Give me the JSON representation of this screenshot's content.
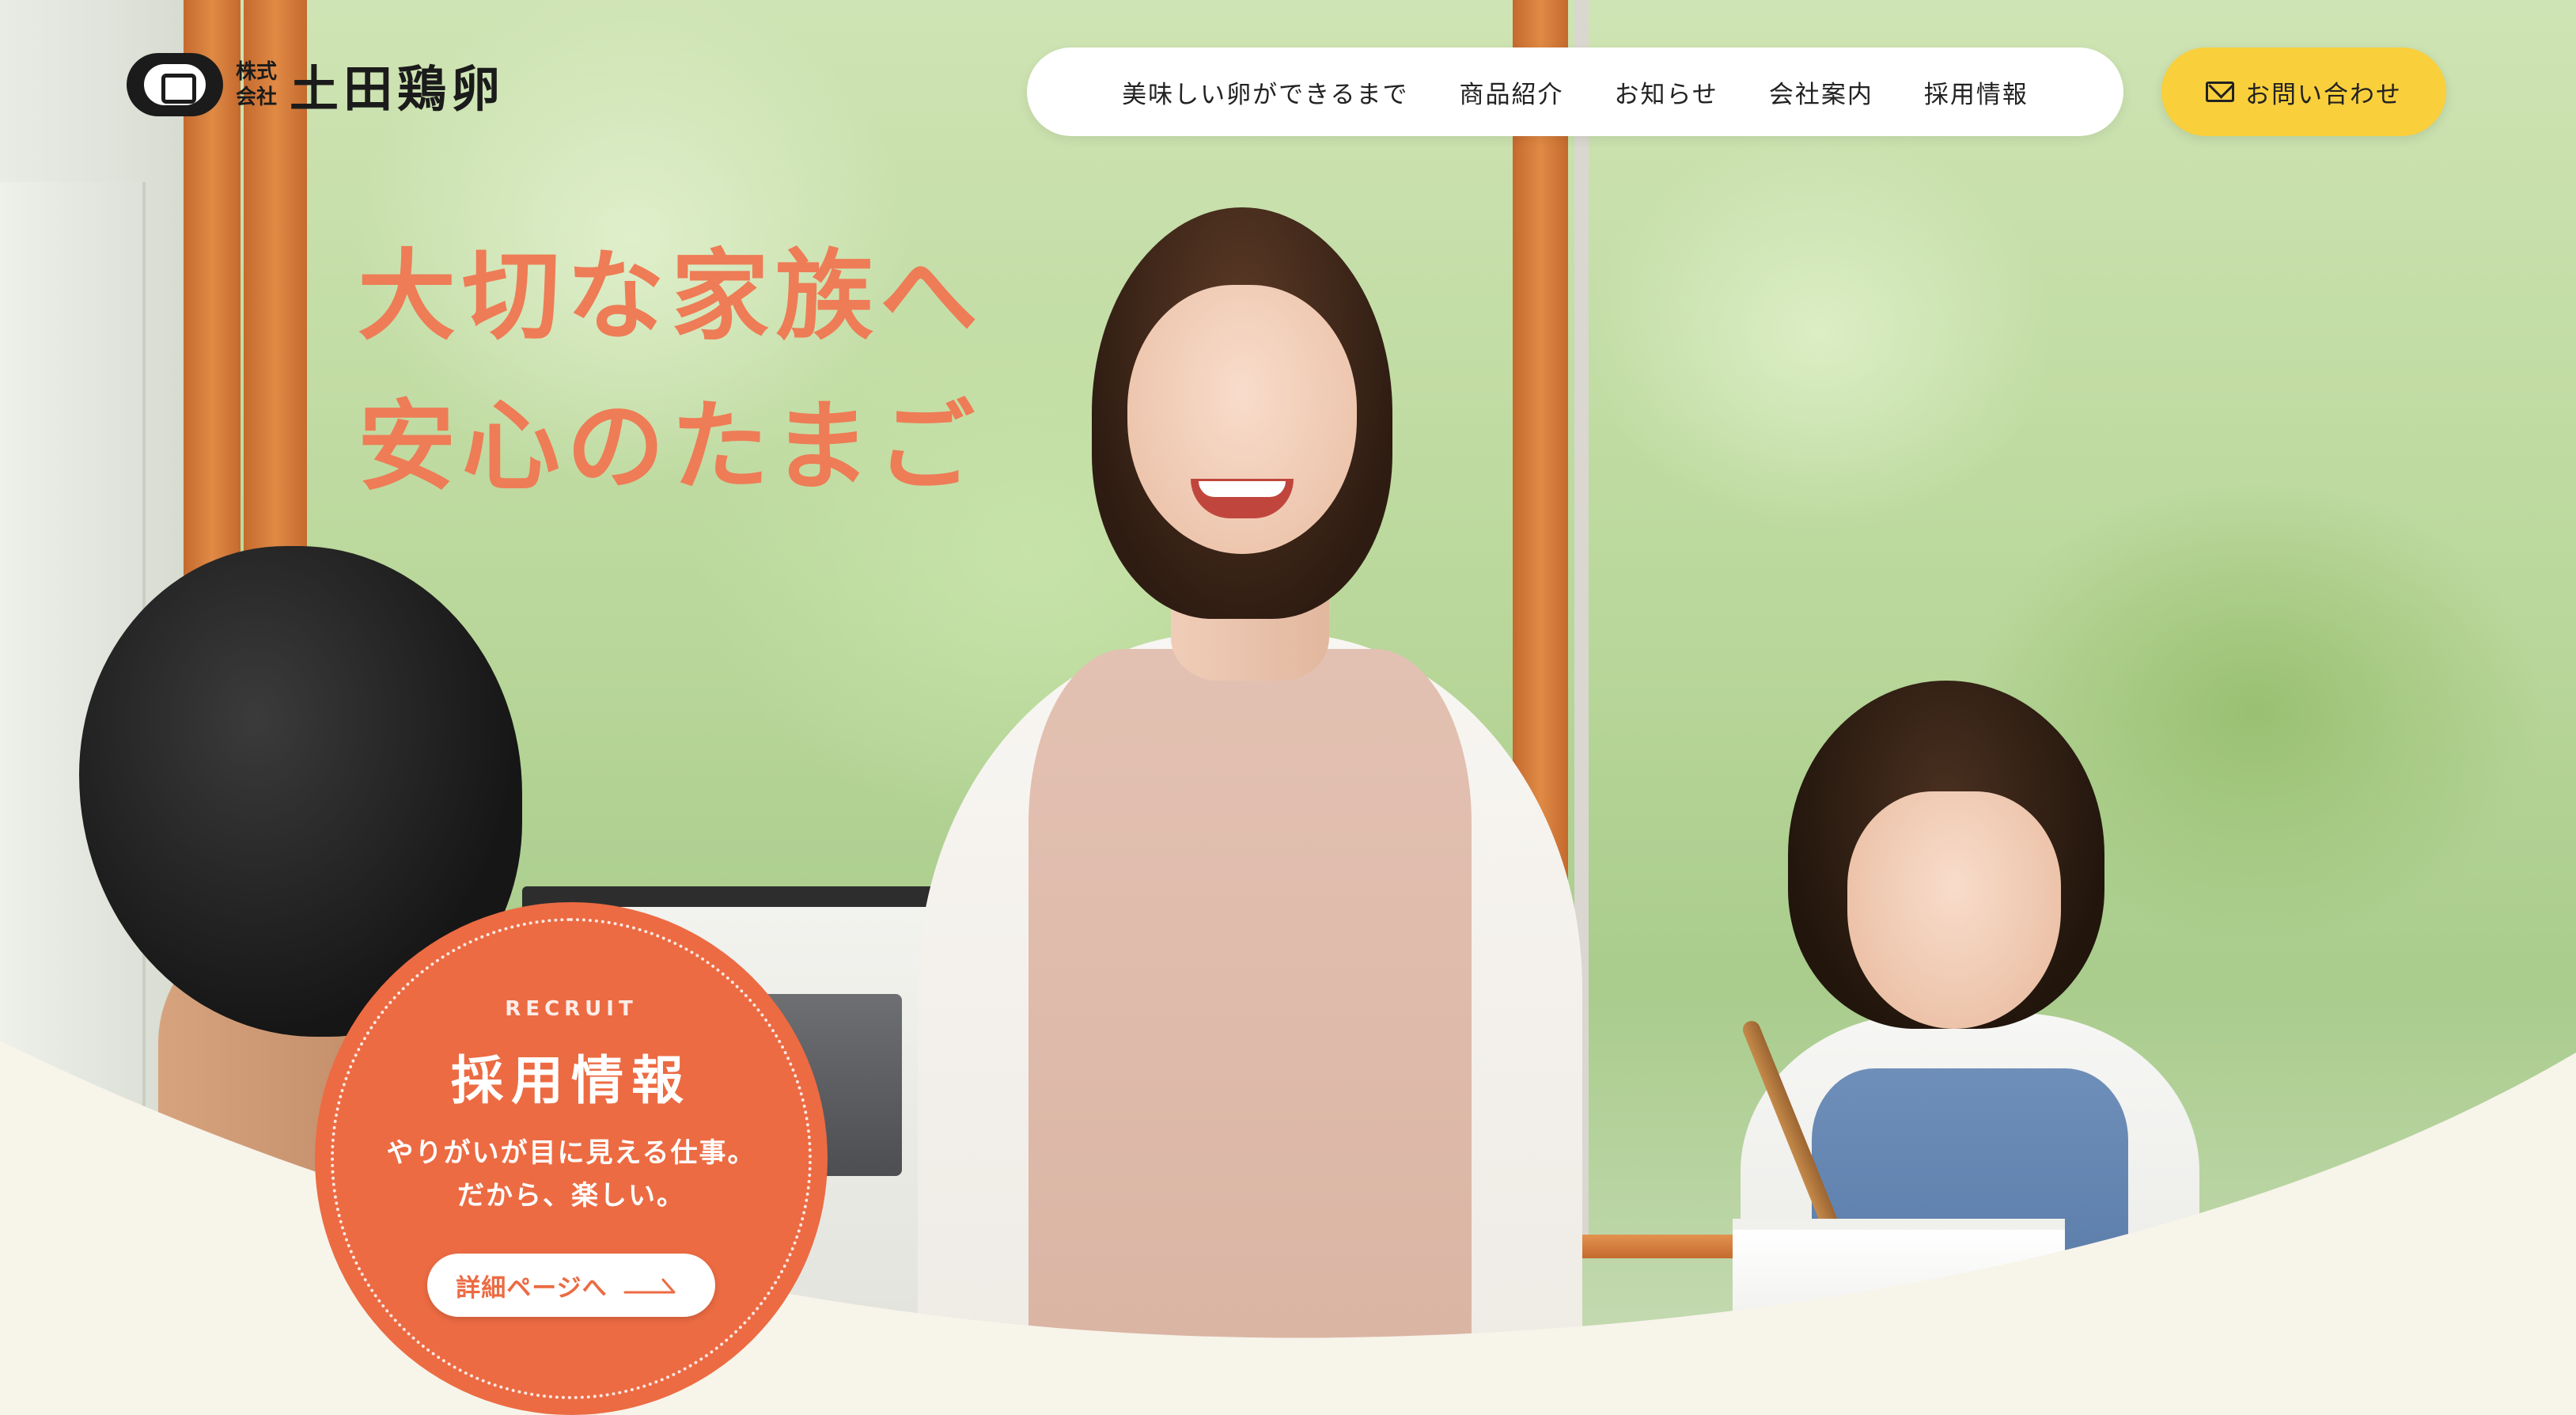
{
  "header": {
    "logo": {
      "small_top": "株式",
      "small_bottom": "会社",
      "name": "土田鶏卵"
    },
    "nav": {
      "items": [
        {
          "label": "美味しい卵ができるまで"
        },
        {
          "label": "商品紹介"
        },
        {
          "label": "お知らせ"
        },
        {
          "label": "会社案内"
        },
        {
          "label": "採用情報"
        }
      ]
    },
    "contact": {
      "label": "お問い合わせ",
      "icon": "mail-icon"
    }
  },
  "hero": {
    "catch_line1": "大切な家族へ",
    "catch_line2": "安心のたまご",
    "catch_color": "#ee7c56"
  },
  "recruit": {
    "en": "RECRUIT",
    "title": "採用情報",
    "text_line1": "やりがいが目に見える仕事。",
    "text_line2": "だから、楽しい。",
    "button_label": "詳細ページへ",
    "button_icon": "arrow-right-icon",
    "color": "#ec6b43"
  },
  "colors": {
    "accent_yellow": "#f9cf3c",
    "accent_orange": "#ec6b43",
    "base_cream": "#f7f4ea"
  }
}
